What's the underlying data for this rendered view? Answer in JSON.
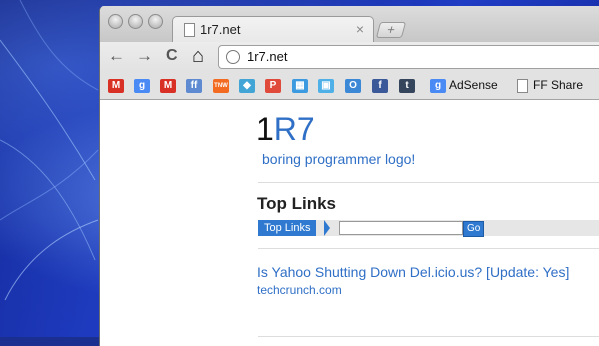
{
  "browser": {
    "tab_title": "1r7.net",
    "tab_close": "×",
    "new_tab": "+",
    "url": "1r7.net",
    "back": "←",
    "forward": "→",
    "reload": "C",
    "home": "⌂"
  },
  "bookmarks": {
    "items": [
      {
        "icon": "gmail-icon",
        "glyph": "M",
        "color": "#d93025"
      },
      {
        "icon": "google-icon",
        "glyph": "g",
        "color": "#4a8af4"
      },
      {
        "icon": "gmail-icon",
        "glyph": "M",
        "color": "#d93025"
      },
      {
        "icon": "friendfeed-icon",
        "glyph": "ff",
        "color": "#5d8ad0"
      },
      {
        "icon": "tnw-icon",
        "glyph": "TNW",
        "color": "#f26b21"
      },
      {
        "icon": "bookmark-icon",
        "glyph": "◆",
        "color": "#42a5d6"
      },
      {
        "icon": "posterous-icon",
        "glyph": "P",
        "color": "#e04a3a"
      },
      {
        "icon": "landscape-icon",
        "glyph": "▦",
        "color": "#3c9be0"
      },
      {
        "icon": "image-icon",
        "glyph": "▣",
        "color": "#4fb0e8"
      },
      {
        "icon": "ring-icon",
        "glyph": "O",
        "color": "#3a88d6"
      },
      {
        "icon": "facebook-icon",
        "glyph": "f",
        "color": "#3b5998"
      },
      {
        "icon": "tumblr-icon",
        "glyph": "t",
        "color": "#35465c"
      },
      {
        "icon": "adsense-icon",
        "glyph": "g",
        "color": "#4a8af4"
      }
    ],
    "adsense_label": "AdSense",
    "ffshare_label": "FF Share"
  },
  "page": {
    "logo_one": "1",
    "logo_r7": "R7",
    "tagline": "boring programmer logo!",
    "section_heading": "Top Links",
    "linkbar_tab": "Top Links",
    "search_value": "",
    "go_label": "Go",
    "article_title": "Is Yahoo Shutting Down Del.icio.us? [Update: Yes]",
    "article_source": "techcrunch.com"
  },
  "colors": {
    "link_blue": "#2f6fc6",
    "tab_blue": "#2f7ad0"
  }
}
